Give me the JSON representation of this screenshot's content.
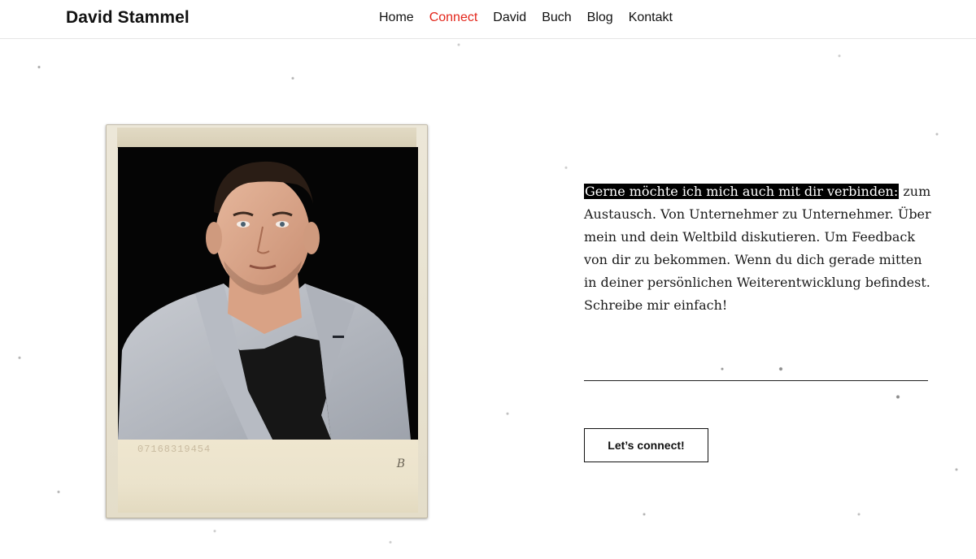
{
  "header": {
    "logo": "David Stammel",
    "nav": [
      {
        "label": "Home",
        "active": false
      },
      {
        "label": "Connect",
        "active": true
      },
      {
        "label": "David",
        "active": false
      },
      {
        "label": "Buch",
        "active": false
      },
      {
        "label": "Blog",
        "active": false
      },
      {
        "label": "Kontakt",
        "active": false
      }
    ],
    "active_color": "#e3261b"
  },
  "photo": {
    "film_code": "07168319454",
    "film_letter": "B"
  },
  "intro": {
    "highlight": "Gerne möchte ich mich auch mit dir verbinden:",
    "body": " zum Austausch. Von Unternehmer zu Unternehmer. Über mein und dein Weltbild diskutieren. Um Feedback von dir zu bekommen. Wenn du dich gerade mitten in deiner persönlichen Weiterentwicklung befindest. Schreibe mir einfach!"
  },
  "cta": {
    "label": "Let’s connect!"
  }
}
